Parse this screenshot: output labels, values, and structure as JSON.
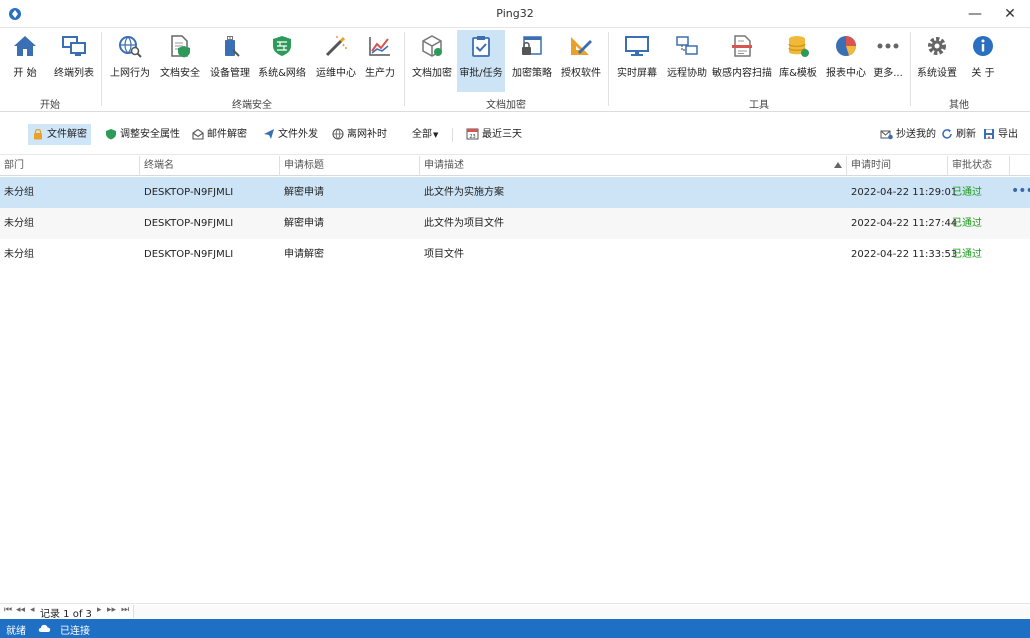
{
  "window": {
    "title": "Ping32",
    "minimize": "—",
    "close": "✕"
  },
  "ribbon": {
    "groups": [
      {
        "label": "开始"
      },
      {
        "label": "终端安全"
      },
      {
        "label": "文档加密"
      },
      {
        "label": "工具"
      },
      {
        "label": "其他"
      }
    ],
    "buttons": [
      {
        "label": "开 始",
        "icon": "home-icon"
      },
      {
        "label": "终端列表",
        "icon": "monitors-icon"
      },
      {
        "label": "上网行为",
        "icon": "globe-search-icon"
      },
      {
        "label": "文档安全",
        "icon": "document-shield-icon"
      },
      {
        "label": "设备管理",
        "icon": "usb-device-icon"
      },
      {
        "label": "系统&网络",
        "icon": "firewall-shield-icon"
      },
      {
        "label": "运维中心",
        "icon": "magic-wand-icon"
      },
      {
        "label": "生产力",
        "icon": "chart-line-icon"
      },
      {
        "label": "文档加密",
        "icon": "cube-icon"
      },
      {
        "label": "审批/任务",
        "icon": "clipboard-check-icon"
      },
      {
        "label": "加密策略",
        "icon": "lock-window-icon"
      },
      {
        "label": "授权软件",
        "icon": "ruler-pencil-icon"
      },
      {
        "label": "实时屏幕",
        "icon": "screen-icon"
      },
      {
        "label": "远程协助",
        "icon": "remote-network-icon"
      },
      {
        "label": "敏感内容扫描",
        "icon": "scan-document-icon"
      },
      {
        "label": "库&模板",
        "icon": "database-icon"
      },
      {
        "label": "报表中心",
        "icon": "pie-chart-icon"
      },
      {
        "label": "更多...",
        "icon": "more-dots-icon"
      },
      {
        "label": "系统设置",
        "icon": "gear-icon"
      },
      {
        "label": "关 于",
        "icon": "info-icon"
      }
    ]
  },
  "filters": {
    "items": [
      {
        "label": "文件解密",
        "icon": "lock-icon"
      },
      {
        "label": "调整安全属性",
        "icon": "shield-icon"
      },
      {
        "label": "邮件解密",
        "icon": "mail-icon"
      },
      {
        "label": "文件外发",
        "icon": "send-icon"
      },
      {
        "label": "离网补时",
        "icon": "globe-icon"
      }
    ],
    "scope": "全部",
    "range": "最近三天",
    "cc": "抄送我的",
    "refresh": "刷新",
    "export": "导出"
  },
  "table": {
    "columns": [
      "部门",
      "终端名",
      "申请标题",
      "申请描述",
      "申请时间",
      "审批状态"
    ],
    "rows": [
      {
        "dept": "未分组",
        "terminal": "DESKTOP-N9FJMLI",
        "title": "解密申请",
        "desc": "此文件为实施方案",
        "time": "2022-04-22 11:29:01",
        "status": "已通过"
      },
      {
        "dept": "未分组",
        "terminal": "DESKTOP-N9FJMLI",
        "title": "解密申请",
        "desc": "此文件为项目文件",
        "time": "2022-04-22 11:27:44",
        "status": "已通过"
      },
      {
        "dept": "未分组",
        "terminal": "DESKTOP-N9FJMLI",
        "title": "申请解密",
        "desc": "项目文件",
        "time": "2022-04-22 11:33:53",
        "status": "已通过"
      }
    ],
    "row_more": "•••"
  },
  "pager": {
    "first": "⏮",
    "prev_page": "◂◂",
    "prev": "◂",
    "record": "记录 1 of 3",
    "next": "▸",
    "next_page": "▸▸",
    "last": "⏭"
  },
  "status": {
    "ready": "就绪",
    "connection": "已连接"
  },
  "colors": {
    "accent": "#1f6fc5",
    "selection": "#cde4f7",
    "approved": "#1a9a1a"
  }
}
